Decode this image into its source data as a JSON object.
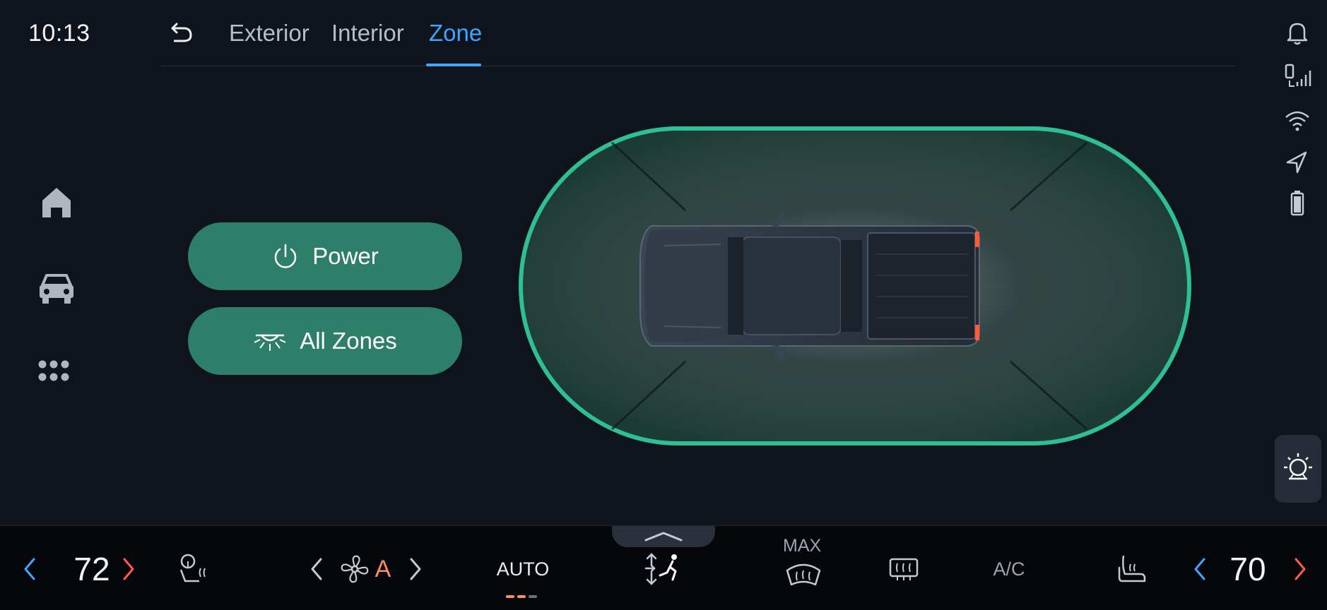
{
  "status": {
    "time": "10:13"
  },
  "tabs": [
    {
      "label": "Exterior"
    },
    {
      "label": "Interior"
    },
    {
      "label": "Zone"
    }
  ],
  "active_tab": "Zone",
  "actions": {
    "power_label": "Power",
    "all_zones_label": "All Zones"
  },
  "climate": {
    "driver_temp": "72",
    "passenger_temp": "70",
    "fan_mode": "A",
    "auto_label": "AUTO",
    "max_label": "MAX",
    "ac_label": "A/C"
  },
  "colors": {
    "accent": "#3ea6ff",
    "zone_green": "#2fbf95",
    "button_green": "#2d7f6a",
    "temp_arrow_left": "#3ea6ff",
    "temp_arrow_right": "#ff5a4a",
    "fan_auto": "#ff8a63"
  },
  "icons": {
    "back": "back-arrow-icon",
    "filter": "filter-icon",
    "home": "home-icon",
    "vehicle": "car-icon",
    "apps": "apps-grid-icon",
    "notifications": "bell-icon",
    "signal": "phone-signal-icon",
    "wifi": "wifi-icon",
    "navigation": "navigation-arrow-icon",
    "battery": "battery-icon",
    "lights": "light-bulb-icon"
  }
}
